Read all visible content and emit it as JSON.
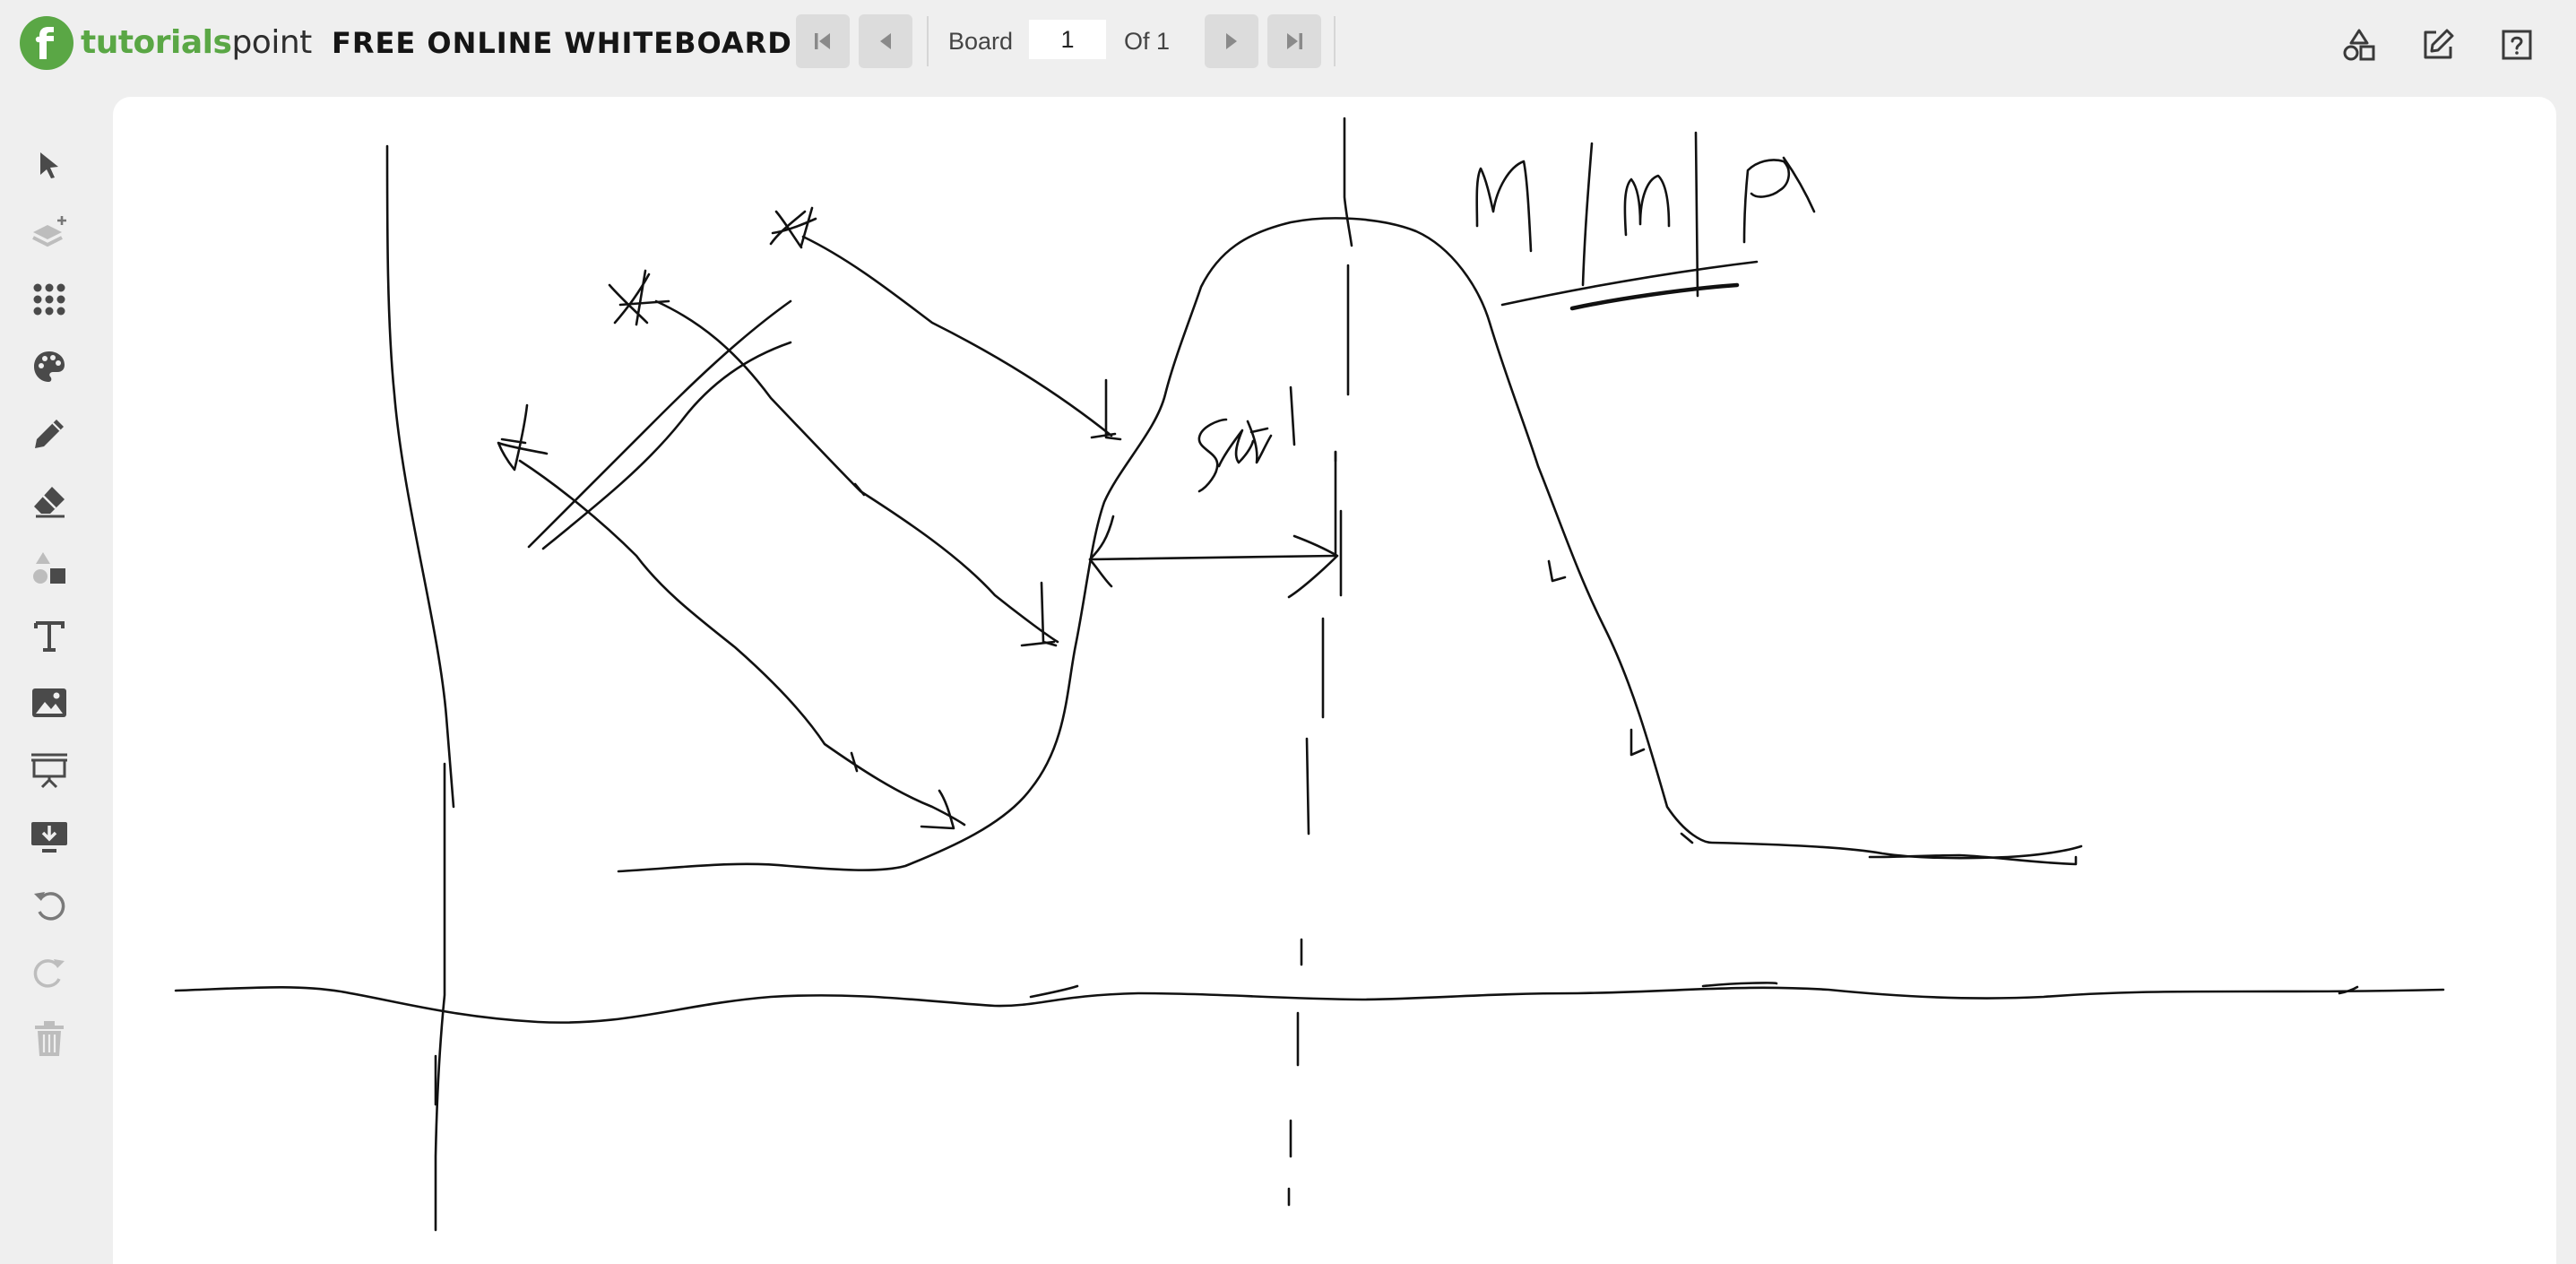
{
  "brand": {
    "logo_bold": "tutorials",
    "logo_light": "point",
    "app_title": "FREE ONLINE WHITEBOARD",
    "accent_color": "#5aa745"
  },
  "pager": {
    "board_label": "Board",
    "board_value": "1",
    "of_label": "Of 1",
    "buttons": [
      "first-page-icon",
      "prev-page-icon",
      "next-page-icon",
      "last-page-icon"
    ]
  },
  "header_actions": [
    "shapes-icon",
    "edit-icon",
    "help-icon"
  ],
  "tools": [
    {
      "name": "select",
      "icon": "pointer-icon"
    },
    {
      "name": "add-layer",
      "icon": "layers-add-icon"
    },
    {
      "name": "grid",
      "icon": "dots-grid-icon"
    },
    {
      "name": "color",
      "icon": "palette-icon"
    },
    {
      "name": "pencil",
      "icon": "pencil-icon"
    },
    {
      "name": "eraser",
      "icon": "eraser-icon"
    },
    {
      "name": "shapes",
      "icon": "shapes-icon"
    },
    {
      "name": "text",
      "icon": "text-icon"
    },
    {
      "name": "image",
      "icon": "image-icon"
    },
    {
      "name": "presentation",
      "icon": "presentation-icon"
    },
    {
      "name": "download",
      "icon": "download-icon"
    },
    {
      "name": "undo",
      "icon": "undo-icon"
    },
    {
      "name": "redo",
      "icon": "redo-icon"
    },
    {
      "name": "delete",
      "icon": "trash-icon"
    }
  ],
  "canvas": {
    "background": "#ffffff",
    "ink_color": "#111111"
  }
}
